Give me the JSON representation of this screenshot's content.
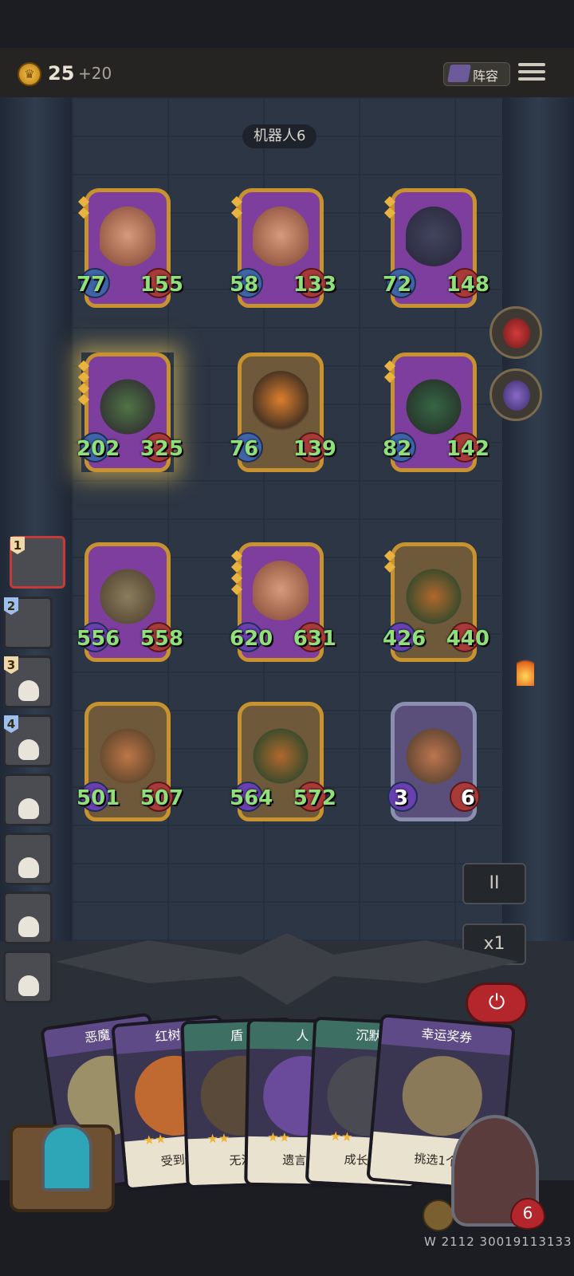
{
  "header": {
    "gold": "25",
    "gold_increment": "+20",
    "lineup_label": "阵容"
  },
  "opponent": {
    "name": "机器人6"
  },
  "board": {
    "row1": [
      {
        "atk": "77",
        "hp": "155"
      },
      {
        "atk": "58",
        "hp": "133"
      },
      {
        "atk": "72",
        "hp": "148"
      }
    ],
    "row2": [
      {
        "atk": "202",
        "hp": "325"
      },
      {
        "atk": "76",
        "hp": "139"
      },
      {
        "atk": "82",
        "hp": "142"
      }
    ],
    "row3": [
      {
        "atk": "556",
        "hp": "558"
      },
      {
        "atk": "620",
        "hp": "631"
      },
      {
        "atk": "426",
        "hp": "440"
      }
    ],
    "row4": [
      {
        "atk": "501",
        "hp": "507"
      },
      {
        "atk": "564",
        "hp": "572"
      },
      {
        "atk": "3",
        "hp": "6"
      }
    ]
  },
  "queue": [
    "1",
    "2",
    "3",
    "4"
  ],
  "controls": {
    "pause": "II",
    "speed": "x1",
    "power": "⏻"
  },
  "hand": [
    {
      "title": "恶魔",
      "desc": ""
    },
    {
      "title": "红树",
      "desc": "受到伤"
    },
    {
      "title": "盾",
      "desc": "无法"
    },
    {
      "title": "人",
      "desc": "遗言："
    },
    {
      "title": "沉默",
      "desc": "成长："
    },
    {
      "title": "幸运奖券",
      "desc": "挑选1个"
    }
  ],
  "hero": {
    "hp": "6"
  },
  "build_id": "W 2112 30019113133"
}
